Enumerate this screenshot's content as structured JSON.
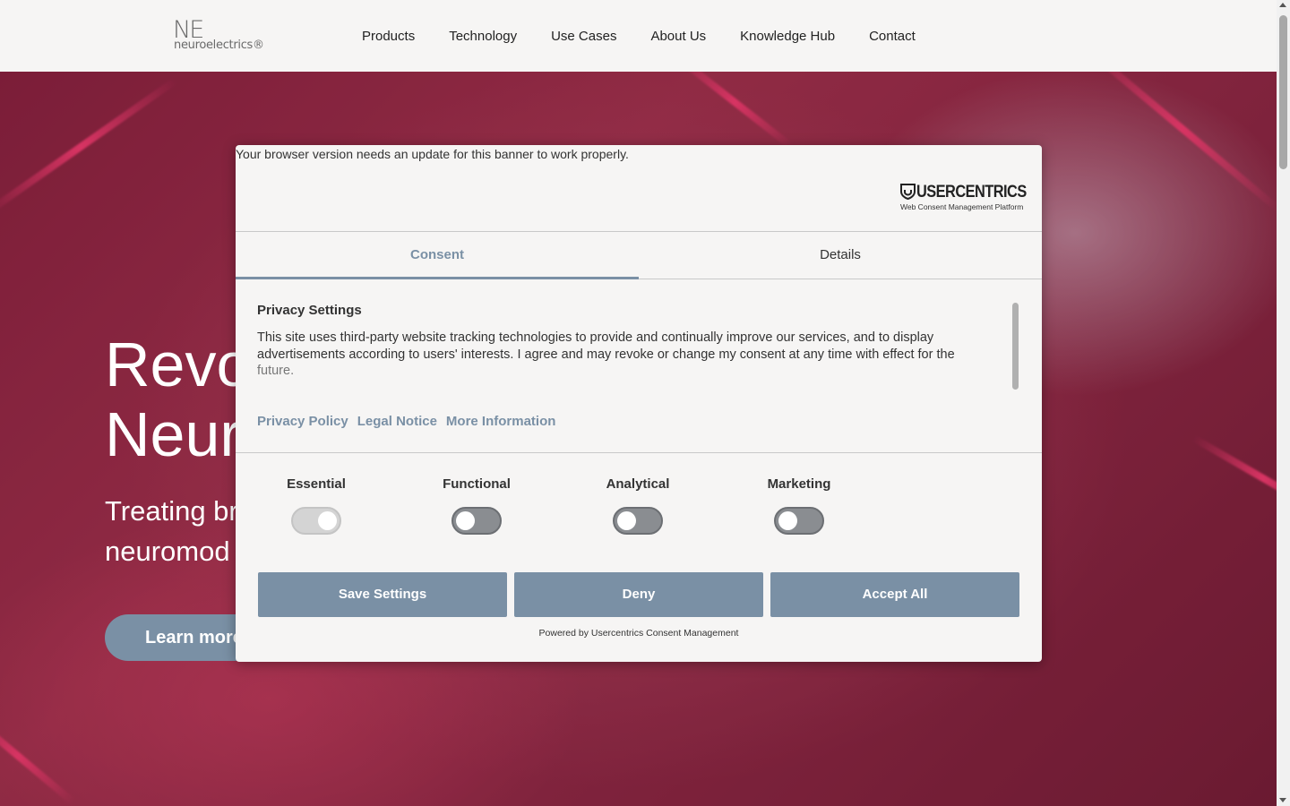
{
  "header": {
    "logo_mark": "NE",
    "logo_text": "neuroelectrics®",
    "nav": [
      "Products",
      "Technology",
      "Use Cases",
      "About Us",
      "Knowledge Hub",
      "Contact"
    ]
  },
  "hero": {
    "title_line1": "Revo",
    "title_line2": "Neur",
    "subtitle_line1": "Treating br",
    "subtitle_line2": "neuromod",
    "cta": "Learn more"
  },
  "consent": {
    "browser_warning": "Your browser version needs an update for this banner to work properly.",
    "brand": "USERCENTRICS",
    "brand_sub": "Web Consent Management Platform",
    "tabs": [
      "Consent",
      "Details"
    ],
    "privacy_title": "Privacy Settings",
    "privacy_text": "This site uses third-party website tracking technologies to provide and continually improve our services, and to display advertisements according to users' interests. I agree and may revoke or change my consent at any time with effect for the",
    "privacy_text_fade": "future.",
    "links": [
      "Privacy Policy",
      "Legal Notice",
      "More Information"
    ],
    "categories": [
      {
        "label": "Essential",
        "enabled": true,
        "locked": true
      },
      {
        "label": "Functional",
        "enabled": false,
        "locked": false
      },
      {
        "label": "Analytical",
        "enabled": false,
        "locked": false
      },
      {
        "label": "Marketing",
        "enabled": false,
        "locked": false
      }
    ],
    "buttons": {
      "save": "Save Settings",
      "deny": "Deny",
      "accept": "Accept All"
    },
    "powered_by": "Powered by Usercentrics Consent Management"
  },
  "colors": {
    "accent": "#7a90a5",
    "hero_pink": "#ff3d74",
    "hero_base": "#962a47",
    "panel_bg": "#f6f5f4"
  }
}
